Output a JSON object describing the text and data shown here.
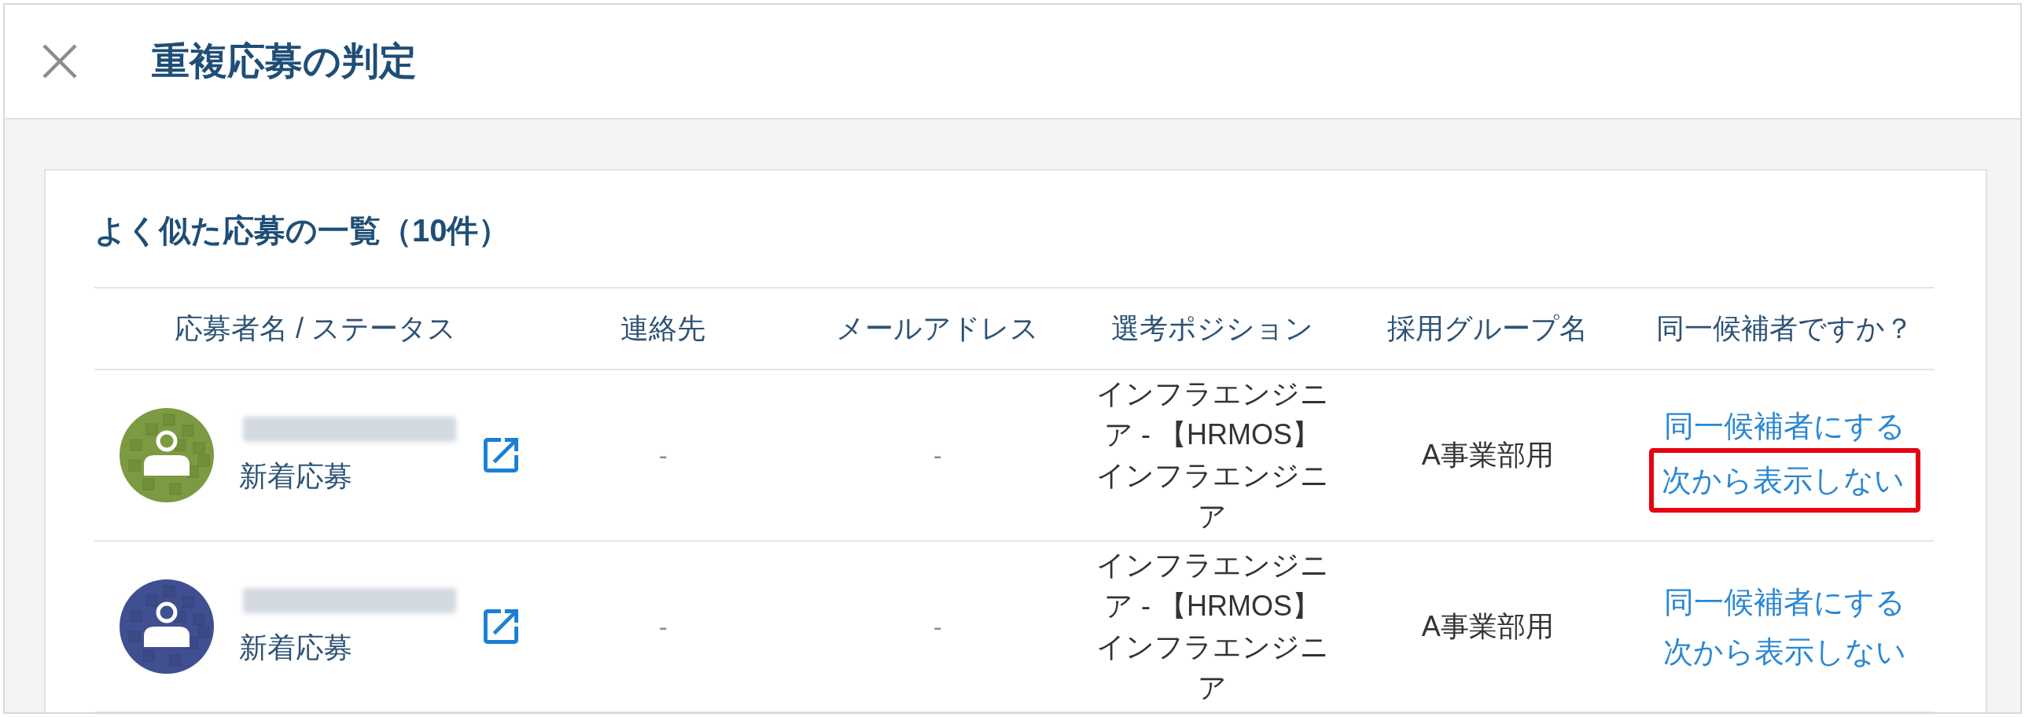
{
  "window": {
    "title": "重複応募の判定"
  },
  "list": {
    "heading": "よく似た応募の一覧（10件）",
    "columns": [
      "応募者名 / ステータス",
      "連絡先",
      "メールアドレス",
      "選考ポジション",
      "採用グループ名",
      "同一候補者ですか？"
    ],
    "rows": [
      {
        "avatar": {
          "color": "#7b9a41"
        },
        "status": "新着応募",
        "contact": "-",
        "email": "-",
        "position": "インフラエンジニア - 【HRMOS】インフラエンジニア",
        "group": "A事業部用",
        "actions": [
          {
            "label": "同一候補者にする",
            "highlighted": false
          },
          {
            "label": "次から表示しない",
            "highlighted": true
          }
        ]
      },
      {
        "avatar": {
          "color": "#404f91"
        },
        "status": "新着応募",
        "contact": "-",
        "email": "-",
        "position": "インフラエンジニア - 【HRMOS】インフラエンジニア",
        "group": "A事業部用",
        "actions": [
          {
            "label": "同一候補者にする",
            "highlighted": false
          },
          {
            "label": "次から表示しない",
            "highlighted": false
          }
        ]
      }
    ]
  }
}
